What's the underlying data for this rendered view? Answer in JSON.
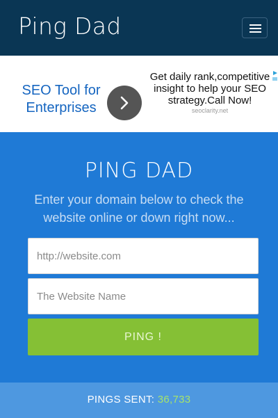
{
  "header": {
    "brand": "Ping Dad",
    "menu_icon": "hamburger-menu-icon"
  },
  "ad": {
    "left_text": "SEO Tool for Enterprises",
    "arrow_icon": "chevron-right-icon",
    "right_text": "Get daily rank,competitive insight to help your SEO strategy.Call Now!",
    "source": "seoclarity.net",
    "choices_icon": "ad-choices-icon"
  },
  "hero": {
    "title": "PING DAD",
    "subtitle": "Enter your domain below to check the website online or down right now...",
    "url_placeholder": "http://website.com",
    "name_placeholder": "The Website Name",
    "ping_label": "PING !"
  },
  "footer": {
    "label": "PINGS SENT:",
    "count": "36,733"
  },
  "colors": {
    "navbar": "#0a3654",
    "hero": "#1f7ad6",
    "button": "#85c035",
    "footer": "#4e98e0",
    "count": "#a6e36a"
  }
}
